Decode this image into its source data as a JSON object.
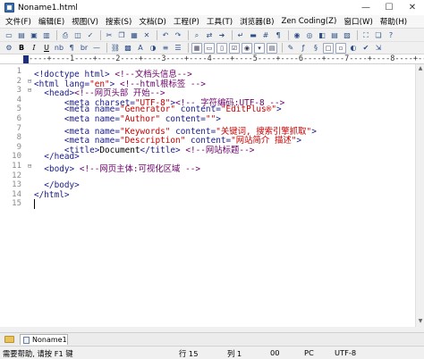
{
  "window": {
    "title": "Noname1.html",
    "controls": [
      "—",
      "☐",
      "✕"
    ]
  },
  "menu": [
    "文件(F)",
    "编辑(E)",
    "视图(V)",
    "搜索(S)",
    "文档(D)",
    "工程(P)",
    "工具(T)",
    "浏览器(B)",
    "Zen Coding(Z)",
    "窗口(W)",
    "帮助(H)"
  ],
  "toolbar1_icons": [
    "new-file-icon",
    "open-folder-icon",
    "save-icon",
    "save-all-icon",
    "print-icon",
    "print-preview-icon",
    "spell-check-icon",
    "cut-icon",
    "copy-icon",
    "paste-icon",
    "delete-icon",
    "undo-icon",
    "redo-icon",
    "find-icon",
    "replace-icon",
    "go-to-icon",
    "word-wrap-icon",
    "ruler-icon",
    "line-number-icon",
    "whitespace-icon",
    "browser-icon",
    "preview-icon",
    "html-toolbar-icon",
    "cliptext-icon",
    "directory-icon",
    "full-screen-icon",
    "window-icon"
  ],
  "toolbar2": {
    "bold": "B",
    "italic": "I",
    "underline": "U",
    "nbsp": "nb",
    "paragraph": "¶",
    "break": "br",
    "hr": "—"
  },
  "ruler": {
    "text": "----+----1----+----2----+----3----+----4----+----5----+----6----+----7----+----8----+----9"
  },
  "editor": {
    "line_numbers": [
      "1",
      "2",
      "3",
      "4",
      "5",
      "6",
      "7",
      "8",
      "9",
      "10",
      "11",
      "12",
      "13",
      "14",
      "15"
    ],
    "lines": [
      [
        {
          "c": "tag",
          "t": "<!doctype html>"
        },
        {
          "c": "txt",
          "t": " "
        },
        {
          "c": "com",
          "t": "<!--文档头信息-->"
        }
      ],
      [
        {
          "c": "tag",
          "t": "<html lang="
        },
        {
          "c": "val",
          "t": "\"en\""
        },
        {
          "c": "tag",
          "t": ">"
        },
        {
          "c": "txt",
          "t": " "
        },
        {
          "c": "com",
          "t": "<!--html根标签 -->"
        }
      ],
      [
        {
          "c": "txt",
          "t": "  "
        },
        {
          "c": "tag",
          "t": "<head>"
        },
        {
          "c": "com",
          "t": "<!--网页头部 开始-->"
        }
      ],
      [
        {
          "c": "txt",
          "t": "      "
        },
        {
          "c": "tag",
          "t": "<meta charset="
        },
        {
          "c": "val",
          "t": "\"UTF-8\""
        },
        {
          "c": "tag",
          "t": ">"
        },
        {
          "c": "com",
          "t": "<!-- 字符编码:UTF-8 -->"
        }
      ],
      [
        {
          "c": "txt",
          "t": "      "
        },
        {
          "c": "tag",
          "t": "<meta name="
        },
        {
          "c": "val",
          "t": "\"Generator\""
        },
        {
          "c": "tag",
          "t": " content="
        },
        {
          "c": "val",
          "t": "\"EditPlus®\""
        },
        {
          "c": "tag",
          "t": ">"
        }
      ],
      [
        {
          "c": "txt",
          "t": "      "
        },
        {
          "c": "tag",
          "t": "<meta name="
        },
        {
          "c": "val",
          "t": "\"Author\""
        },
        {
          "c": "tag",
          "t": " content="
        },
        {
          "c": "val",
          "t": "\"\""
        },
        {
          "c": "tag",
          "t": ">"
        }
      ],
      [
        {
          "c": "txt",
          "t": "      "
        },
        {
          "c": "tag",
          "t": "<meta name="
        },
        {
          "c": "val",
          "t": "\"Keywords\""
        },
        {
          "c": "tag",
          "t": " content="
        },
        {
          "c": "val",
          "t": "\"关键词, 搜索引擎抓取\""
        },
        {
          "c": "tag",
          "t": ">"
        }
      ],
      [
        {
          "c": "txt",
          "t": "      "
        },
        {
          "c": "tag",
          "t": "<meta name="
        },
        {
          "c": "val",
          "t": "\"Description\""
        },
        {
          "c": "tag",
          "t": " content="
        },
        {
          "c": "val",
          "t": "\"网站简介 描述\""
        },
        {
          "c": "tag",
          "t": ">"
        }
      ],
      [
        {
          "c": "txt",
          "t": "      "
        },
        {
          "c": "tag",
          "t": "<title>"
        },
        {
          "c": "txt",
          "t": "Document"
        },
        {
          "c": "tag",
          "t": "</title>"
        },
        {
          "c": "txt",
          "t": " "
        },
        {
          "c": "com",
          "t": "<!--网站标题-->"
        }
      ],
      [
        {
          "c": "txt",
          "t": "  "
        },
        {
          "c": "tag",
          "t": "</head>"
        }
      ],
      [
        {
          "c": "txt",
          "t": "  "
        },
        {
          "c": "tag",
          "t": "<body>"
        },
        {
          "c": "txt",
          "t": " "
        },
        {
          "c": "com",
          "t": "<!--网页主体:可视化区域 -->"
        }
      ],
      [],
      [
        {
          "c": "txt",
          "t": "  "
        },
        {
          "c": "tag",
          "t": "</body>"
        }
      ],
      [
        {
          "c": "tag",
          "t": "</html>"
        }
      ],
      []
    ]
  },
  "tabs": {
    "active": "Noname1"
  },
  "status": {
    "help": "需要帮助, 请按 F1 键",
    "line": "行 15",
    "col": "列 1",
    "num": "00",
    "mode": "PC",
    "encoding": "UTF-8"
  }
}
